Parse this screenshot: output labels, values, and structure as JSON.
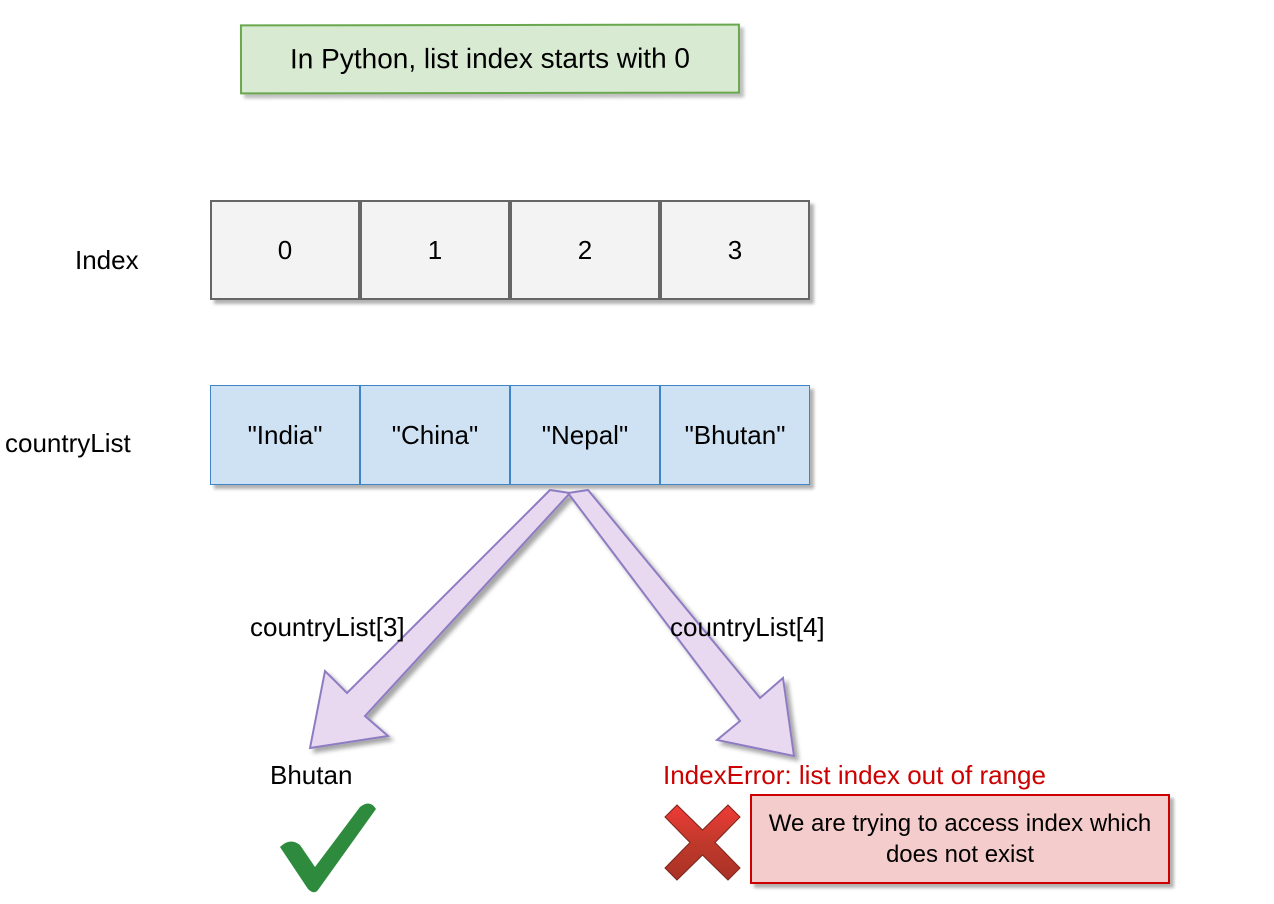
{
  "title": "In Python, list index starts with 0",
  "rowLabels": {
    "index": "Index",
    "list": "countryList"
  },
  "indexRow": [
    "0",
    "1",
    "2",
    "3"
  ],
  "listRow": [
    "\"India\"",
    "\"China\"",
    "\"Nepal\"",
    "\"Bhutan\""
  ],
  "leftBranch": {
    "code": "countryList[3]",
    "result": "Bhutan"
  },
  "rightBranch": {
    "code": "countryList[4]",
    "error": "IndexError: list index out of range",
    "note": "We are trying to access index which does not exist"
  }
}
